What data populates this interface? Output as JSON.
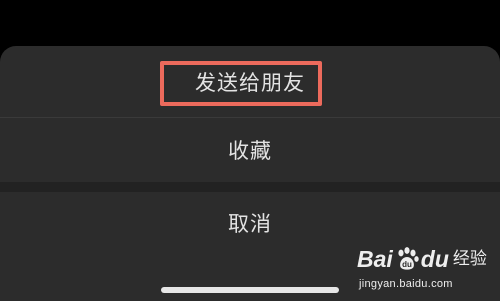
{
  "action_sheet": {
    "options": [
      {
        "label": "发送给朋友",
        "highlighted": true
      },
      {
        "label": "收藏"
      }
    ],
    "cancel_label": "取消",
    "highlight_color": "#ec6a5c"
  },
  "watermark": {
    "brand_part1": "Bai",
    "brand_part2": "du",
    "brand_suffix": "经验",
    "url": "jingyan.baidu.com",
    "icon": "baidu-paw-icon"
  },
  "colors": {
    "background": "#000000",
    "sheet": "#2c2c2c",
    "text": "#e3e3e3"
  }
}
